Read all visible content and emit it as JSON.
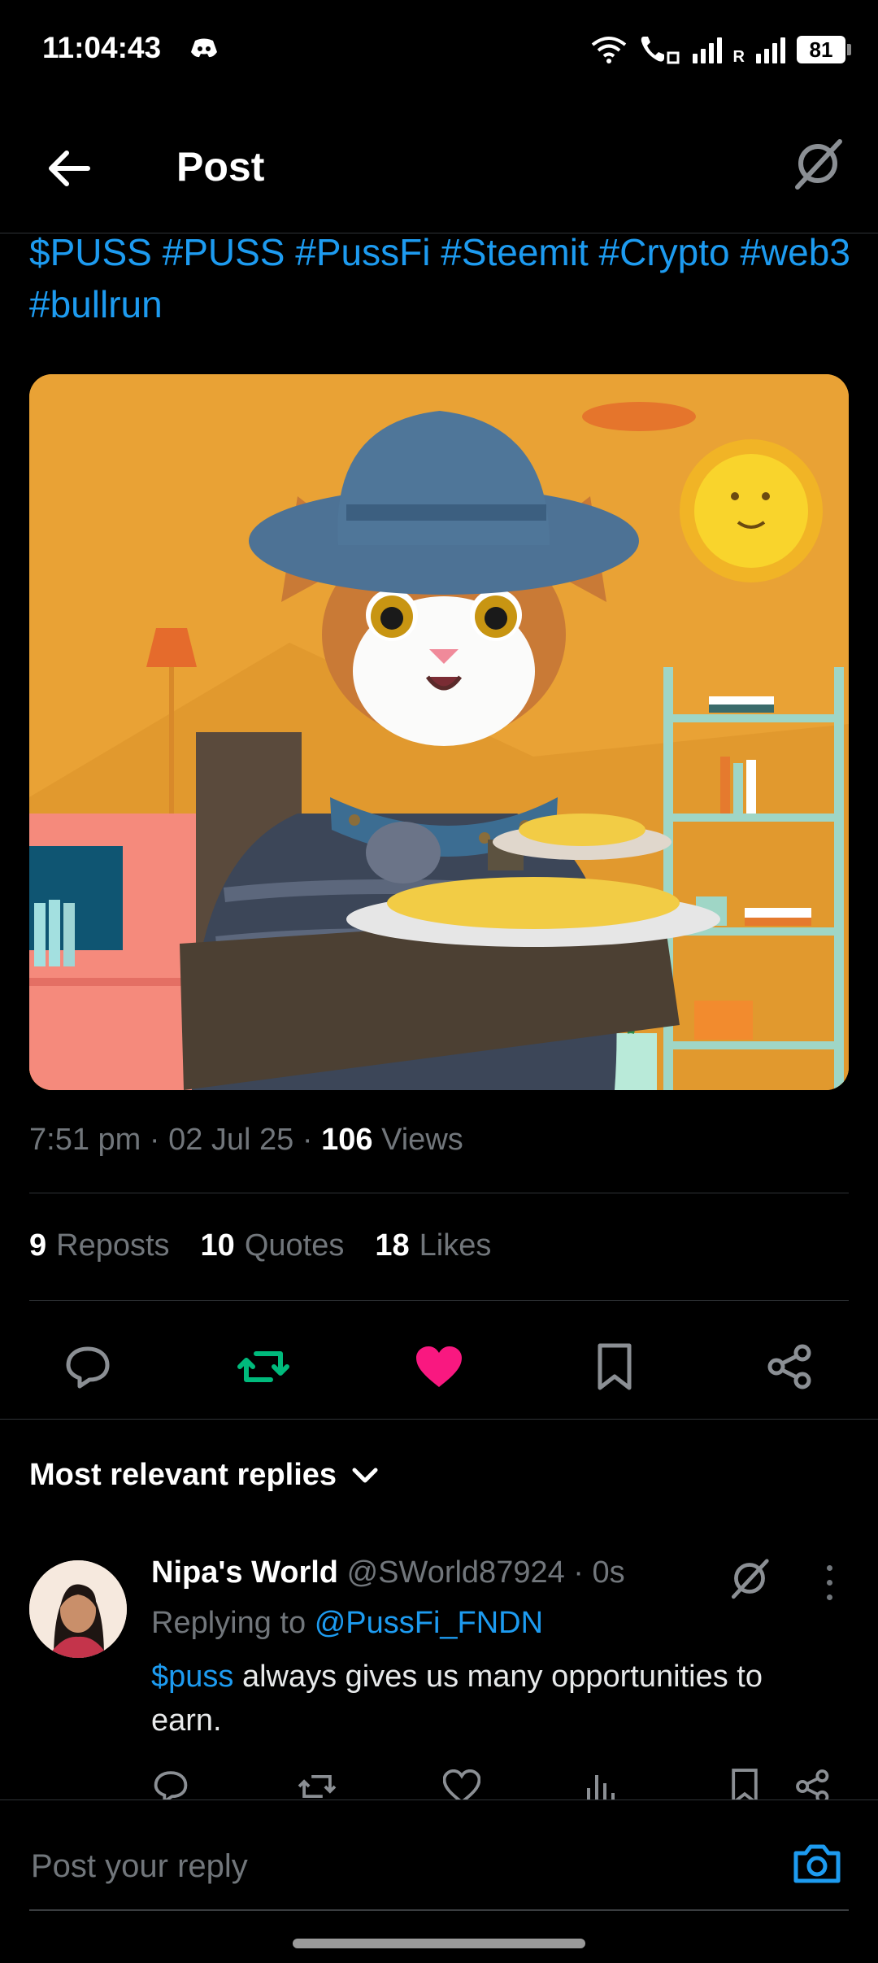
{
  "status_bar": {
    "time": "11:04:43",
    "battery": "81",
    "sim_label": "R"
  },
  "header": {
    "title": "Post"
  },
  "post": {
    "hashtags": "$PUSS #PUSS #PussFi #Steemit #Crypto #web3 #bullrun",
    "time": "7:51 pm",
    "date": "02 Jul 25",
    "views_count": "106",
    "views_label": "Views",
    "stats": {
      "reposts_count": "9",
      "reposts_label": "Reposts",
      "quotes_count": "10",
      "quotes_label": "Quotes",
      "likes_count": "18",
      "likes_label": "Likes"
    }
  },
  "colors": {
    "accent": "#1d9bf0",
    "repost_active": "#00ba7c",
    "like_active": "#f91880",
    "background": "#000000"
  },
  "replies": {
    "sort_label": "Most relevant replies",
    "items": [
      {
        "name": "Nipa's World",
        "handle": "@SWorld87924",
        "time": "0s",
        "replying_label": "Replying to",
        "replying_to": "@PussFi_FNDN",
        "cashtag": "$puss",
        "text": " always gives us many opportunities to earn."
      }
    ]
  },
  "compose": {
    "placeholder": "Post your reply"
  },
  "icons": {
    "back": "back-arrow-icon",
    "grok": "grok-icon",
    "reply": "reply-icon",
    "repost": "repost-icon",
    "like": "heart-icon",
    "bookmark": "bookmark-icon",
    "share": "share-icon",
    "views": "views-icon",
    "camera": "camera-icon",
    "more": "more-icon",
    "chevron": "chevron-down-icon"
  }
}
